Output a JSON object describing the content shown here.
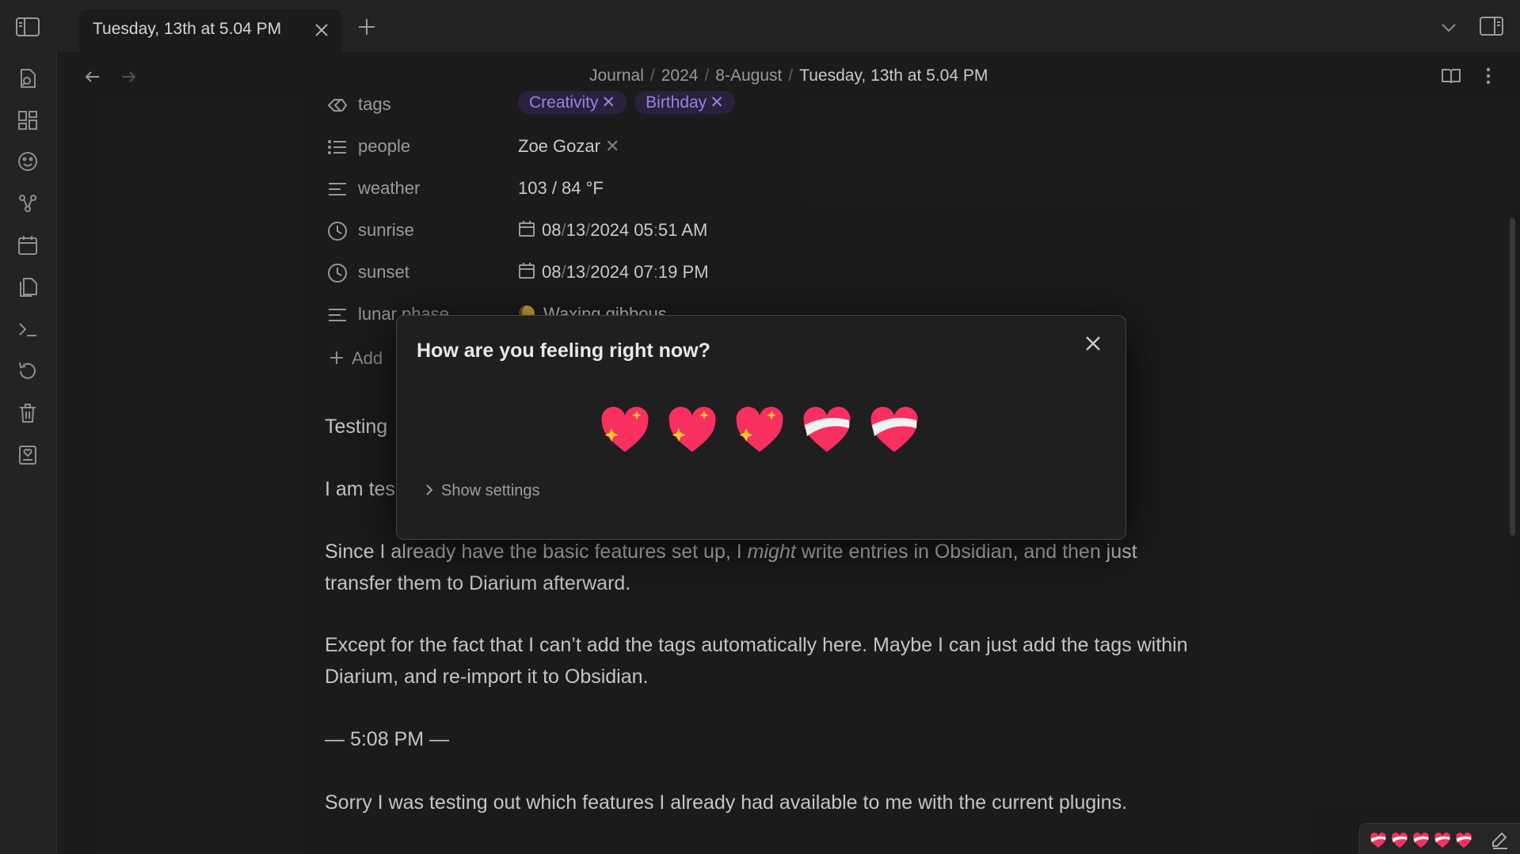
{
  "tab": {
    "title": "Tuesday, 13th at 5.04 PM"
  },
  "breadcrumb": {
    "items": [
      "Journal",
      "2024",
      "8-August"
    ],
    "current": "Tuesday, 13th at 5.04 PM"
  },
  "properties": {
    "tags": {
      "key": "tags",
      "values": [
        "Creativity",
        "Birthday"
      ]
    },
    "people": {
      "key": "people",
      "value": "Zoe Gozar"
    },
    "weather": {
      "key": "weather",
      "value": "103 / 84 °F"
    },
    "sunrise": {
      "key": "sunrise",
      "date": [
        "08",
        "13",
        "2024"
      ],
      "time": [
        "05",
        "51"
      ],
      "ampm": "AM"
    },
    "sunset": {
      "key": "sunset",
      "date": [
        "08",
        "13",
        "2024"
      ],
      "time": [
        "07",
        "19"
      ],
      "ampm": "PM"
    },
    "lunar_phase": {
      "key": "lunar phase",
      "value": "Waxing gibbous"
    },
    "add_label": "Add"
  },
  "body": {
    "heading_partial": "Testing",
    "line_partial": "I am tes",
    "para1_before": "Since I already have the basic features set up, I ",
    "para1_em": "might",
    "para1_after": " write entries in Obsidian, and then just transfer them to Diarium afterward.",
    "para2": "Except for the fact that I can’t add the tags automatically here. Maybe I can just add the tags within Diarium, and re-import it to Obsidian.",
    "time_divider": "— 5:08 PM —",
    "para3": "Sorry I was testing out which features I already had available to me with the current plugins."
  },
  "modal": {
    "title": "How are you feeling right now?",
    "show_settings": "Show settings",
    "moods": [
      "sparkling-heart",
      "sparkling-heart",
      "sparkling-heart",
      "mending-heart",
      "mending-heart"
    ]
  },
  "colors": {
    "heart_pink": "#f7305f",
    "tag_purple": "#a88bfa",
    "tag_bg": "#2e2540"
  }
}
